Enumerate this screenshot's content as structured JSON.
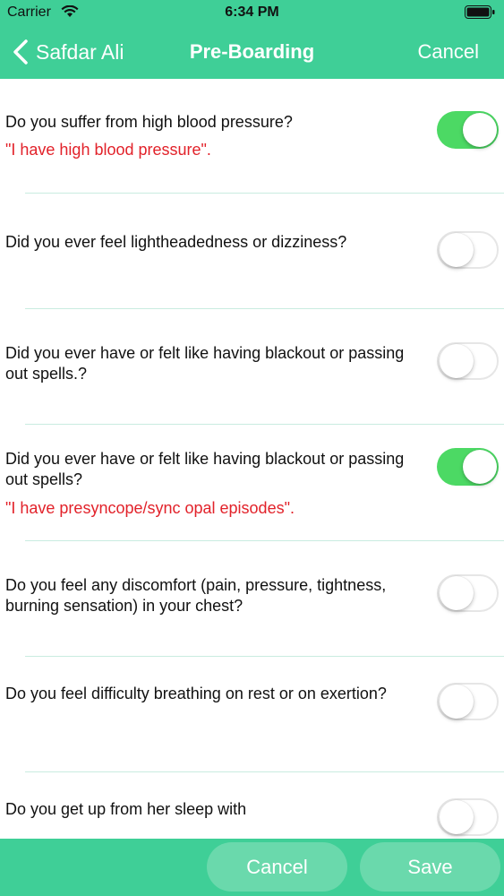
{
  "status": {
    "carrier": "Carrier",
    "time": "6:34 PM"
  },
  "nav": {
    "back_label": "Safdar Ali",
    "title": "Pre-Boarding",
    "cancel_label": "Cancel"
  },
  "questions": [
    {
      "text": "Do you suffer from high blood pressure?",
      "answer": "\"I have high blood pressure\".",
      "on": true
    },
    {
      "text": "Did you ever feel lightheadedness or dizziness?",
      "answer": "",
      "on": false
    },
    {
      "text": "Did you ever have or felt like having blackout or passing out spells.?",
      "answer": "",
      "on": false
    },
    {
      "text": "Did you ever have or felt like having blackout or passing out spells?",
      "answer": "\"I have presyncope/sync opal episodes\".",
      "on": true
    },
    {
      "text": "Do you feel any discomfort (pain, pressure, tightness, burning sensation) in your chest?",
      "answer": "",
      "on": false
    },
    {
      "text": "Do you feel difficulty breathing on rest or on exertion?",
      "answer": "",
      "on": false
    },
    {
      "text": "Do you get up from her sleep with",
      "answer": "",
      "on": false
    }
  ],
  "footer": {
    "cancel_label": "Cancel",
    "save_label": "Save"
  },
  "colors": {
    "accent": "#3fcf97",
    "toggle_on": "#4cd964",
    "answer_text": "#e2222a",
    "footer_button": "#6ad9ac"
  }
}
